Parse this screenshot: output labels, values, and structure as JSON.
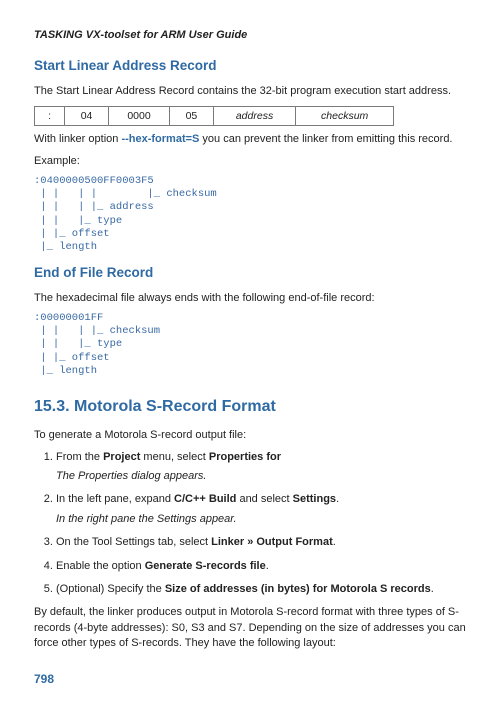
{
  "doc_title": "TASKING VX-toolset for ARM User Guide",
  "h_slar": "Start Linear Address Record",
  "slar_desc": "The Start Linear Address Record contains the 32-bit program execution start address.",
  "table_slar": {
    "c1": ":",
    "c2": "04",
    "c3": "0000",
    "c4": "05",
    "c5": "address",
    "c6": "checksum"
  },
  "slar_linker_pre": "With linker option ",
  "slar_linker_opt": "--hex-format=S",
  "slar_linker_post": " you can prevent the linker from emitting this record.",
  "example_label": "Example:",
  "slar_ascii": ":0400000500FF0003F5\n | |   | |        |_ checksum\n | |   | |_ address\n | |   |_ type\n | |_ offset\n |_ length",
  "h_eof": "End of File Record",
  "eof_desc": "The hexadecimal file always ends with the following end-of-file record:",
  "eof_ascii": ":00000001FF\n | |   | |_ checksum\n | |   |_ type\n | |_ offset\n |_ length",
  "h_motorola": "15.3. Motorola S-Record Format",
  "mot_intro": "To generate a Motorola S-record output file:",
  "steps": {
    "s1_pre": "From the ",
    "s1_b1": "Project",
    "s1_mid": " menu, select ",
    "s1_b2": "Properties for",
    "s1_note": "The Properties dialog appears.",
    "s2_pre": "In the left pane, expand ",
    "s2_b1": "C/C++ Build",
    "s2_mid": " and select ",
    "s2_b2": "Settings",
    "s2_post": ".",
    "s2_note": "In the right pane the Settings appear.",
    "s3_pre": "On the Tool Settings tab, select ",
    "s3_b1": "Linker » Output Format",
    "s3_post": ".",
    "s4_pre": "Enable the option ",
    "s4_b1": "Generate S-records file",
    "s4_post": ".",
    "s5_pre": "(Optional) Specify the ",
    "s5_b1": "Size of addresses (in bytes) for Motorola S records",
    "s5_post": "."
  },
  "mot_footer": "By default, the linker produces output in Motorola S-record format with three types of S-records (4-byte addresses): S0, S3 and S7. Depending on the size of addresses you can force other types of S-records. They have the following layout:",
  "page_number": "798"
}
